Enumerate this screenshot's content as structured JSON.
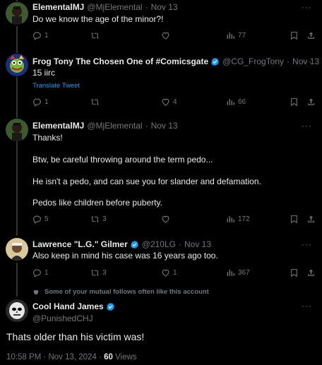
{
  "colors": {
    "background": "#000000",
    "text": "#e7e9ea",
    "muted": "#71767b",
    "accent": "#1d9bf0",
    "divider": "#2f3336"
  },
  "tweets": [
    {
      "name": "ElementalMJ",
      "handle": "@MjElemental",
      "sep": "·",
      "date": "Nov 13",
      "lines": [
        "Do we know the age of the minor?!"
      ],
      "replies": "1",
      "retweets": "",
      "likes": "",
      "views": "77"
    },
    {
      "name": "Frog Tony The Chosen One of #Comicsgate",
      "handle": "@CG_FrogTony",
      "sep": "·",
      "date": "Nov 13",
      "lines": [
        "15 iirc"
      ],
      "translate": "Translate Tweet",
      "replies": "1",
      "retweets": "",
      "likes": "4",
      "views": "66"
    },
    {
      "name": "ElementalMJ",
      "handle": "@MjElemental",
      "sep": "·",
      "date": "Nov 13",
      "lines": [
        "Thanks!",
        "Btw, be careful throwing around the term pedo...",
        "He isn't a pedo, and can sue you for slander and defamation.",
        "Pedos like children before puberty."
      ],
      "replies": "5",
      "retweets": "3",
      "likes": "",
      "views": "172"
    },
    {
      "name": "Lawrence \"L.G.\" Gilmer",
      "handle": "@210LG",
      "sep": "·",
      "date": "Nov 13",
      "lines": [
        "Also keep in mind his case was 16 years ago too."
      ],
      "replies": "1",
      "retweets": "3",
      "likes": "1",
      "views": "367"
    }
  ],
  "main": {
    "social_context": "Some of your mutual follows often like this account",
    "name": "Cool Hand James",
    "handle": "@PunishedCHJ",
    "text": "Thats older than his victim was!",
    "timestamp": "10:58 PM · Nov 13, 2024 · ",
    "views_count": "60",
    "views_label": " Views"
  },
  "more_label": "···"
}
